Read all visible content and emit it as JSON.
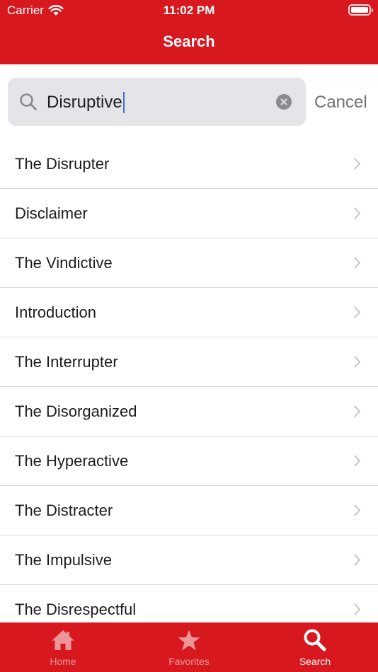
{
  "status": {
    "carrier": "Carrier",
    "time": "11:02 PM"
  },
  "nav": {
    "title": "Search"
  },
  "search": {
    "query": "Disruptive",
    "cancel_label": "Cancel"
  },
  "results": [
    {
      "label": "The Disrupter"
    },
    {
      "label": "Disclaimer"
    },
    {
      "label": "The Vindictive"
    },
    {
      "label": "Introduction"
    },
    {
      "label": "The Interrupter"
    },
    {
      "label": "The Disorganized"
    },
    {
      "label": "The Hyperactive"
    },
    {
      "label": "The Distracter"
    },
    {
      "label": "The Impulsive"
    },
    {
      "label": "The Disrespectful"
    }
  ],
  "tabs": [
    {
      "label": "Home",
      "icon": "home-icon",
      "active": false
    },
    {
      "label": "Favorites",
      "icon": "star-icon",
      "active": false
    },
    {
      "label": "Search",
      "icon": "search-icon",
      "active": true
    }
  ],
  "colors": {
    "brand_red": "#d8181f",
    "searchbox_bg": "#e4e4e9",
    "caret": "#3b6fd8"
  }
}
